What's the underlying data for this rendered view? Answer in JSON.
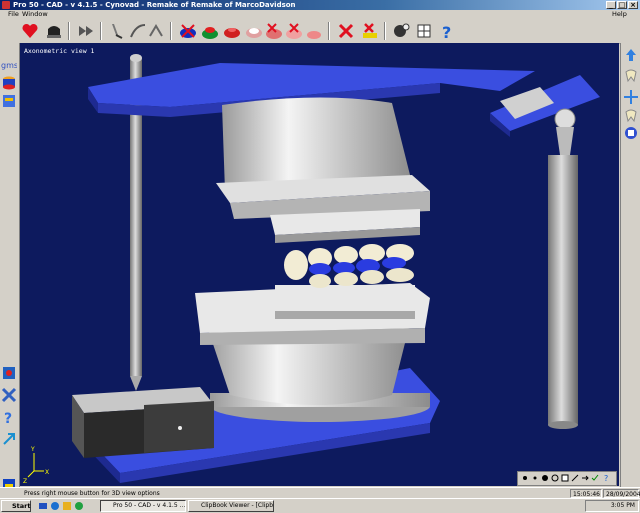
{
  "window": {
    "title": "Pro 50 - CAD - v 4.1.5 - Cynovad - Remake of Remake of MarcoDavidson",
    "minimize": "_",
    "maximize": "□",
    "close": "×"
  },
  "menu": [
    "File",
    "Window",
    "Help"
  ],
  "toolbar": {
    "icons": [
      "heart-icon",
      "crown-icon",
      "fast-forward-icon",
      "wax-knife-icon",
      "probe-tool-icon",
      "spray-tool-icon",
      "arch-blue-icon",
      "arch-green-icon",
      "arch-red-icon",
      "arch-pink-icon",
      "arch-cut-icon",
      "arch-pink-alt-icon",
      "cancel-margin-icon",
      "cancel-yellow-icon",
      "tooth-gear-icon",
      "tooth-grid-icon",
      "help-icon"
    ]
  },
  "viewport": {
    "label": "Axonometric view 1",
    "axis": {
      "y": "Y",
      "x": "X",
      "z": "Z"
    },
    "background": "#0d1a5e",
    "plate_color": "#3a4ee0",
    "gray_color": "#c8c8c8"
  },
  "status": {
    "hint": "Press right mouse button for 3D view options",
    "time": "15:05:46",
    "date": "28/09/2004"
  },
  "taskbar": {
    "start": "Start",
    "tasks": [
      "Pro 50 - CAD - v 4.1.5 ...",
      "ClipBook Viewer - [Clipbo..."
    ],
    "clock": "3:05 PM"
  },
  "sidebar_left": [
    "gms-icon",
    "cylinder-icon",
    "layers-icon",
    "tooth-icon"
  ],
  "sidebar_left_bottom": [
    "paint-icon",
    "tools-icon",
    "question-icon",
    "arrow-icon",
    "disk-icon"
  ],
  "sidebar_right": [
    "arrow-up-icon",
    "tooth-right-icon",
    "move-icon",
    "arch-right-icon",
    "tooth-small-icon",
    "shape-icon"
  ]
}
